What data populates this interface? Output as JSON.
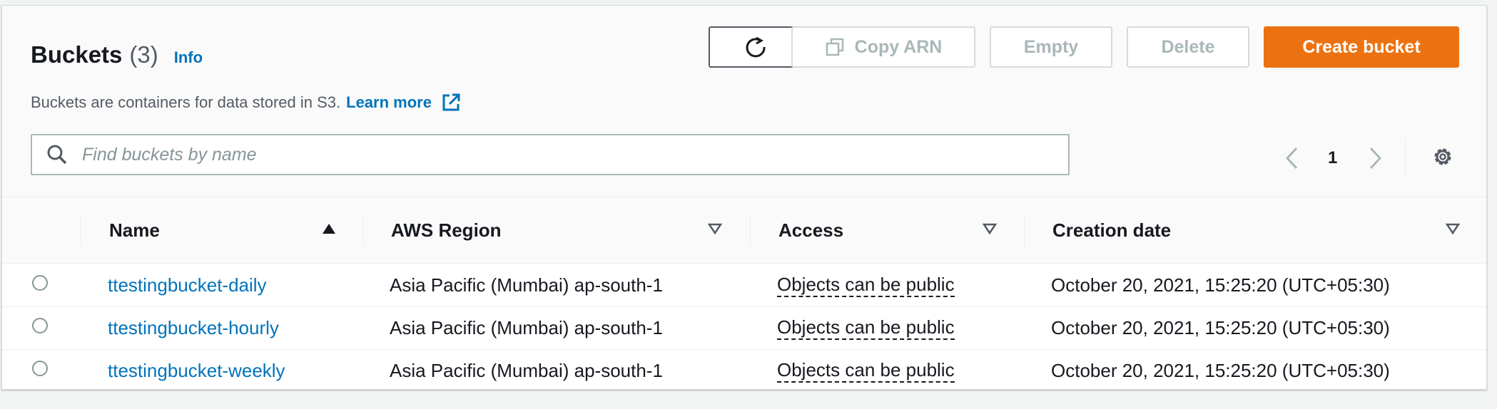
{
  "header": {
    "title": "Buckets",
    "count": "(3)",
    "info_label": "Info",
    "description": "Buckets are containers for data stored in S3.",
    "learn_more_label": "Learn more"
  },
  "toolbar": {
    "refresh_icon": "refresh-icon",
    "copy_arn_label": "Copy ARN",
    "empty_label": "Empty",
    "delete_label": "Delete",
    "create_label": "Create bucket"
  },
  "search": {
    "placeholder": "Find buckets by name",
    "value": ""
  },
  "pagination": {
    "current_page": "1"
  },
  "table": {
    "columns": [
      {
        "label": "Name"
      },
      {
        "label": "AWS Region"
      },
      {
        "label": "Access"
      },
      {
        "label": "Creation date"
      }
    ],
    "rows": [
      {
        "name": "ttestingbucket-daily",
        "region": "Asia Pacific (Mumbai) ap-south-1",
        "access": "Objects can be public",
        "date": "October 20, 2021, 15:25:20 (UTC+05:30)"
      },
      {
        "name": "ttestingbucket-hourly",
        "region": "Asia Pacific (Mumbai) ap-south-1",
        "access": "Objects can be public",
        "date": "October 20, 2021, 15:25:20 (UTC+05:30)"
      },
      {
        "name": "ttestingbucket-weekly",
        "region": "Asia Pacific (Mumbai) ap-south-1",
        "access": "Objects can be public",
        "date": "October 20, 2021, 15:25:20 (UTC+05:30)"
      }
    ]
  },
  "colors": {
    "link": "#0073bb",
    "primary_button": "#ec7211",
    "disabled_text": "#aab7b8",
    "header_background": "#fafafa"
  }
}
